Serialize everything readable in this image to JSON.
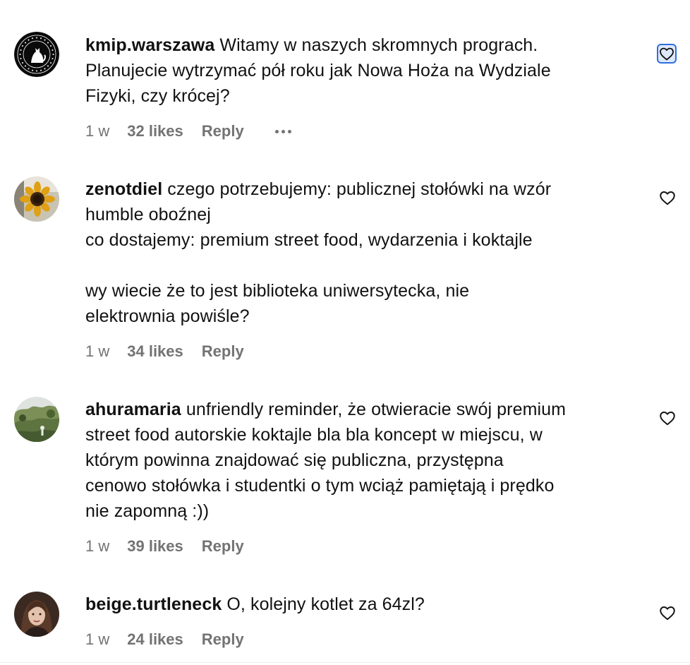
{
  "comments": [
    {
      "username": "kmip.warszawa",
      "text": "Witamy w naszych skromnych prograch.\nPlanujecie wytrzymać pół roku jak Nowa Hoża na Wydziale\nFizyki, czy krócej?",
      "time": "1 w",
      "likes": "32 likes",
      "reply": "Reply",
      "avatar_icon": "cat-logo-avatar"
    },
    {
      "username": "zenotdiel",
      "text": "czego potrzebujemy: publicznej stołówki na wzór\nhumble oboźnej\nco dostajemy: premium street food, wydarzenia i koktajle\n\nwy wiecie że to jest biblioteka uniwersytecka, nie\nelektrownia powiśle?",
      "time": "1 w",
      "likes": "34 likes",
      "reply": "Reply",
      "avatar_icon": "sunflower-avatar"
    },
    {
      "username": "ahuramaria",
      "text": "unfriendly reminder, że otwieracie swój premium\nstreet food autorskie koktajle bla bla koncept w miejscu, w\nktórym powinna znajdować się publiczna, przystępna\ncenowo stołówka i studentki o tym wciąż pamiętają i prędko\nnie zapomną :))",
      "time": "1 w",
      "likes": "39 likes",
      "reply": "Reply",
      "avatar_icon": "landscape-avatar"
    },
    {
      "username": "beige.turtleneck",
      "text": "O, kolejny kotlet za 64zl?",
      "time": "1 w",
      "likes": "24 likes",
      "reply": "Reply",
      "avatar_icon": "portrait-avatar"
    }
  ],
  "colors": {
    "text": "#111111",
    "meta": "#737373",
    "focus_ring": "#2f6fe0"
  }
}
